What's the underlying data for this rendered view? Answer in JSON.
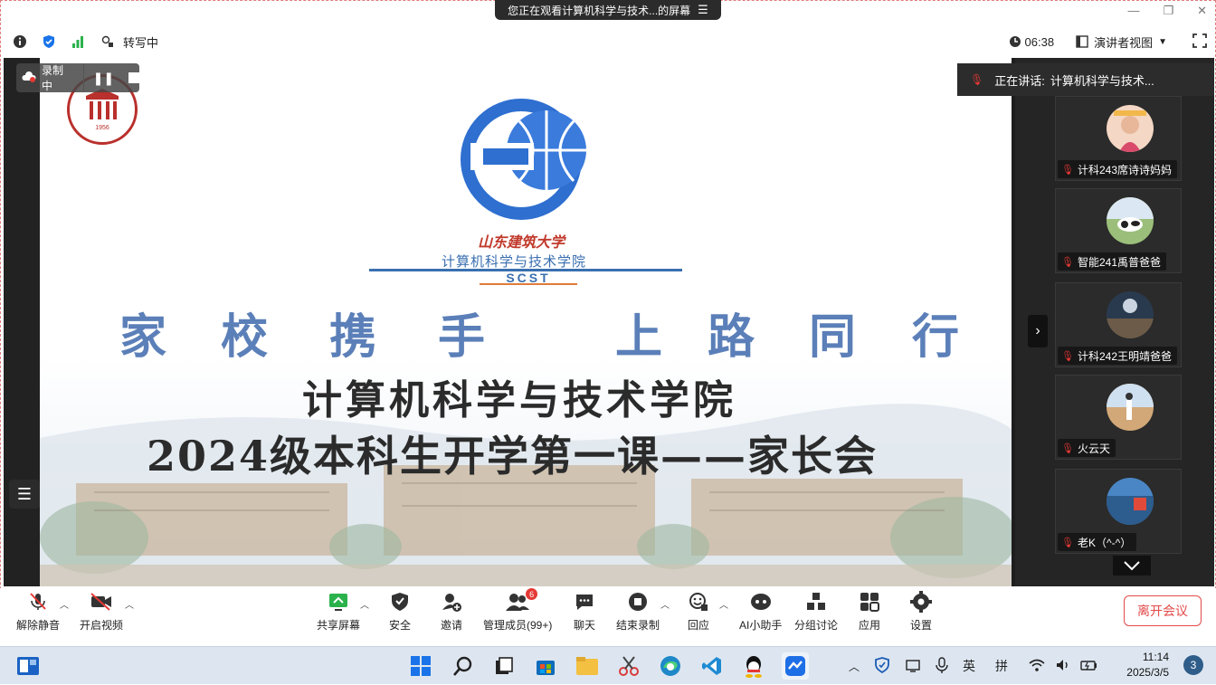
{
  "banner": {
    "text": "您正在观看计算机科学与技术...的屏幕",
    "menu_icon": "menu-icon"
  },
  "topbar": {
    "status": "转写中",
    "time": "06:38",
    "view": "演讲者视图"
  },
  "recording": {
    "label": "录制中"
  },
  "speaking": {
    "label": "正在讲话:",
    "name": "计算机科学与技术..."
  },
  "slide": {
    "college_cn": "计算机科学与技术学院",
    "college_abbr": "SCST",
    "uni_calligraphy": "山东建筑大学",
    "seal_year": "1956",
    "motto": [
      "家",
      "校",
      "携",
      "手",
      "上",
      "路",
      "同",
      "行"
    ],
    "line1": "计算机科学与技术学院",
    "line2": "2024级本科生开学第一课——家长会"
  },
  "participants": [
    {
      "name": "计科243席诗诗妈妈"
    },
    {
      "name": "智能241禹普爸爸"
    },
    {
      "name": "计科242王明靖爸爸"
    },
    {
      "name": "火云天"
    },
    {
      "name": "老K（^-^）"
    }
  ],
  "toolbar": {
    "mute": "解除静音",
    "video": "开启视频",
    "share": "共享屏幕",
    "security": "安全",
    "invite": "邀请",
    "members": "管理成员(99+)",
    "members_badge": "6",
    "chat": "聊天",
    "end_record": "结束录制",
    "react": "回应",
    "ai": "AI小助手",
    "breakout": "分组讨论",
    "apps": "应用",
    "settings": "设置",
    "leave": "离开会议"
  },
  "taskbar": {
    "ime1": "英",
    "ime2": "拼",
    "time": "11:14",
    "date": "2025/3/5",
    "notifications": "3"
  }
}
